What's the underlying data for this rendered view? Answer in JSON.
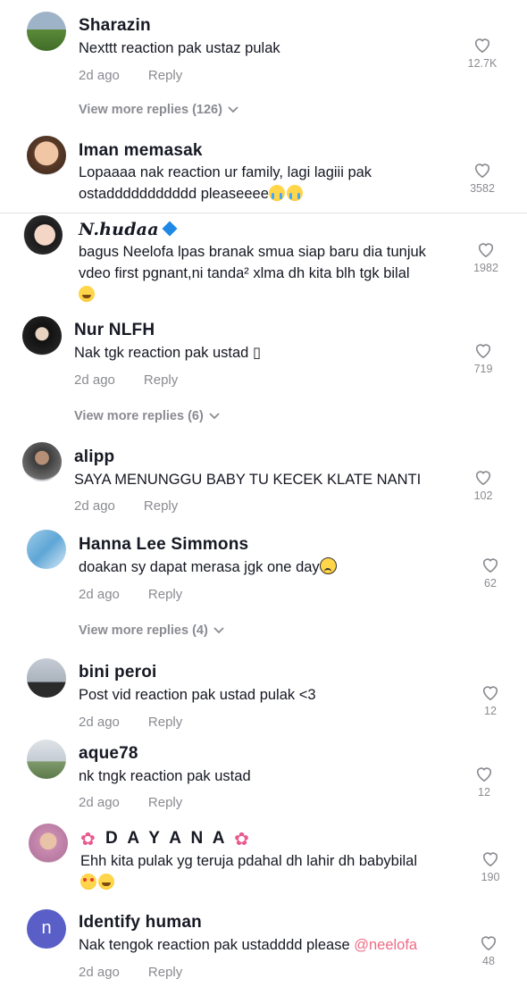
{
  "comments": [
    {
      "name": "Sharazin",
      "text1": "Nexttt reaction pak ustaz pulak",
      "text2": "",
      "time": "2d ago",
      "reply": "Reply",
      "likes": "12.7K",
      "more": "View more replies (126)"
    },
    {
      "name": "Iman memasak",
      "text1": "Lopaaaa nak reaction ur family, lagi lagiii pak",
      "text2": "ostaddddddddddd pleaseeee",
      "time": "",
      "reply": "",
      "likes": "3582",
      "more": ""
    },
    {
      "name": "N.hudaa",
      "text1": "bagus Neelofa lpas branak smua siap baru dia tunjuk",
      "text2": "vdeo first pgnant,ni tanda² xlma dh kita blh tgk bilal",
      "time": "",
      "reply": "",
      "likes": "1982",
      "more": ""
    },
    {
      "name": "Nur NLFH",
      "text1": "Nak tgk reaction pak ustad ▯",
      "text2": "",
      "time": "2d ago",
      "reply": "Reply",
      "likes": "719",
      "more": "View more replies (6)"
    },
    {
      "name": "alipp",
      "text1": "SAYA MENUNGGU BABY TU KECEK KLATE NANTI",
      "text2": "",
      "time": "2d ago",
      "reply": "Reply",
      "likes": "102",
      "more": ""
    },
    {
      "name": "Hanna Lee Simmons",
      "text1": "doakan sy dapat merasa jgk one day",
      "text2": "",
      "time": "2d ago",
      "reply": "Reply",
      "likes": "62",
      "more": "View more replies (4)"
    },
    {
      "name": "bini peroi",
      "text1": "Post vid reaction pak ustad pulak <3",
      "text2": "",
      "time": "2d ago",
      "reply": "Reply",
      "likes": "12",
      "more": ""
    },
    {
      "name": "aque78",
      "text1": "nk tngk reaction pak ustad",
      "text2": "",
      "time": "2d ago",
      "reply": "Reply",
      "likes": "12",
      "more": ""
    },
    {
      "name": "D A Y A N A",
      "text1": "Ehh kita pulak yg teruja pdahal dh lahir dh babybilal",
      "text2": "",
      "time": "",
      "reply": "",
      "likes": "190",
      "more": ""
    },
    {
      "name": "Identify human",
      "text1": "Nak tengok reaction pak ustadddd please",
      "text2": "",
      "mention": "@neelofa",
      "avatar_letter": "n",
      "time": "2d ago",
      "reply": "Reply",
      "likes": "48",
      "more": ""
    }
  ],
  "colors": {
    "muted": "#8a8b91",
    "mention": "#ef6b85",
    "avatar_letter_bg": "#5a5fc8"
  },
  "icons": {
    "like": "heart-outline-icon",
    "expand": "chevron-down-icon"
  }
}
